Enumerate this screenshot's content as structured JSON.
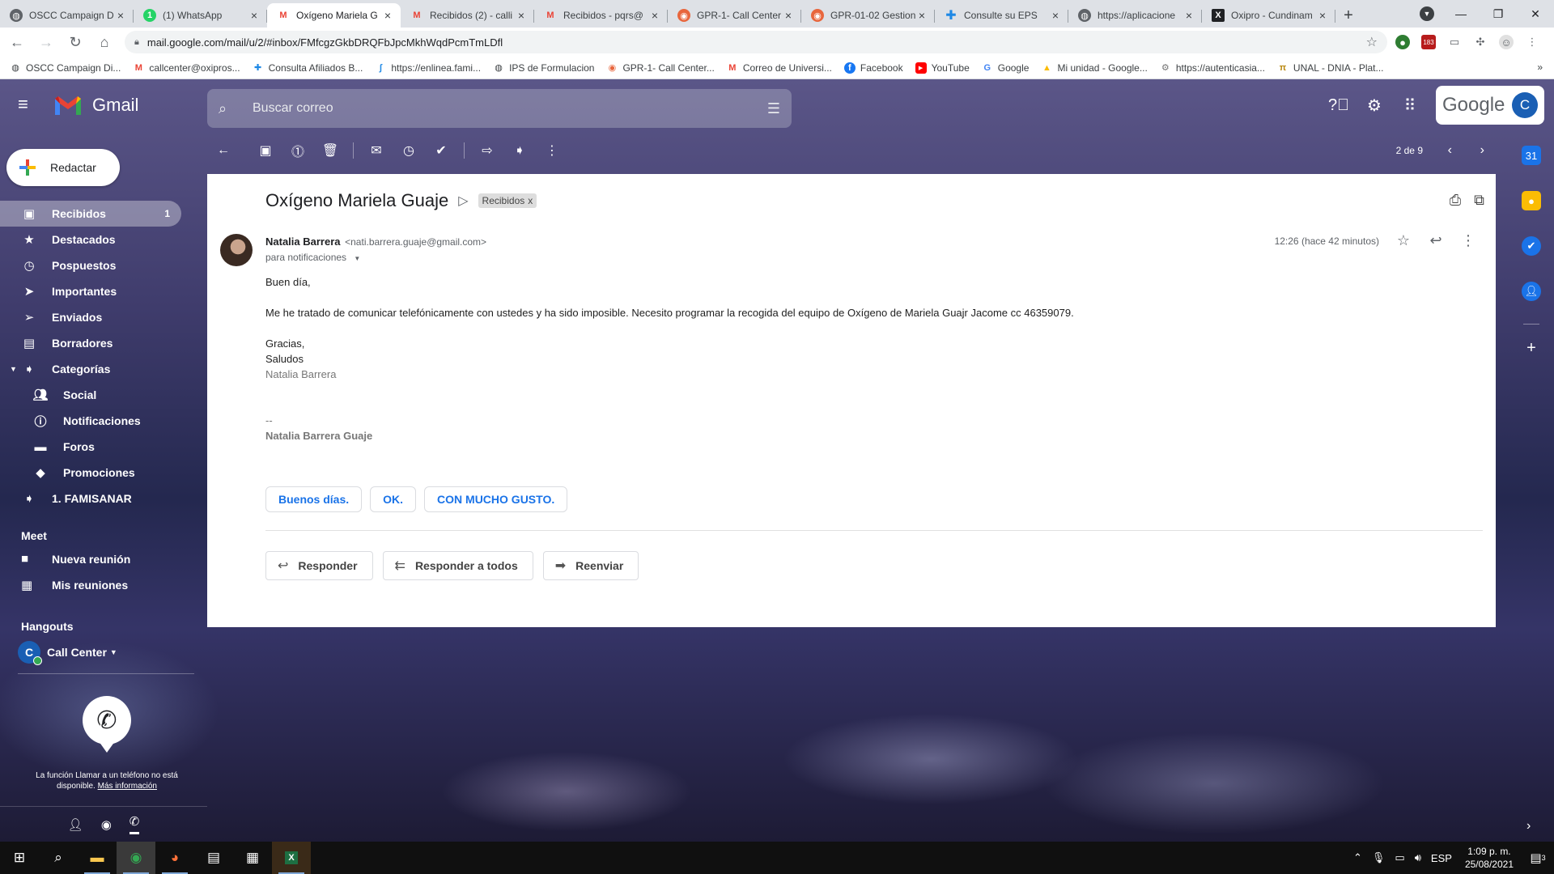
{
  "browser": {
    "tabs": [
      {
        "title": "OSCC Campaign Di",
        "favicon": "globe-icon",
        "active": false
      },
      {
        "title": "(1) WhatsApp",
        "favicon": "whatsapp-icon",
        "active": false
      },
      {
        "title": "Oxígeno Mariela G",
        "favicon": "gmail-icon",
        "active": true
      },
      {
        "title": "Recibidos (2) - calli",
        "favicon": "gmail-icon",
        "active": false
      },
      {
        "title": "Recibidos - pqrs@",
        "favicon": "gmail-icon",
        "active": false
      },
      {
        "title": "GPR-1- Call Center",
        "favicon": "gpr-icon",
        "active": false
      },
      {
        "title": "GPR-01-02 Gestion",
        "favicon": "gpr-icon",
        "active": false
      },
      {
        "title": "Consulte su EPS",
        "favicon": "cross-icon",
        "active": false
      },
      {
        "title": "https://aplicacione",
        "favicon": "globe-icon",
        "active": false
      },
      {
        "title": "Oxipro - Cundinam",
        "favicon": "oxipro-icon",
        "active": false
      }
    ],
    "url": "mail.google.com/mail/u/2/#inbox/FMfcgzGkbDRQFbJpcMkhWqdPcmTmLDfl",
    "extension_badge": "183",
    "bookmarks": [
      {
        "label": "OSCC Campaign Di...",
        "icon": "globe-icon"
      },
      {
        "label": "callcenter@oxipros...",
        "icon": "gmail-icon"
      },
      {
        "label": "Consulta Afiliados B...",
        "icon": "cross-icon"
      },
      {
        "label": "https://enlinea.fami...",
        "icon": "famisanar-icon"
      },
      {
        "label": "IPS de Formulacion",
        "icon": "globe-icon"
      },
      {
        "label": "GPR-1- Call Center...",
        "icon": "gpr-icon"
      },
      {
        "label": "Correo de Universi...",
        "icon": "gmail-icon"
      },
      {
        "label": "Facebook",
        "icon": "facebook-icon"
      },
      {
        "label": "YouTube",
        "icon": "youtube-icon"
      },
      {
        "label": "Google",
        "icon": "google-icon"
      },
      {
        "label": "Mi unidad - Google...",
        "icon": "drive-icon"
      },
      {
        "label": "https://autenticasia...",
        "icon": "gear-icon"
      },
      {
        "label": "UNAL - DNIA - Plat...",
        "icon": "unal-icon"
      }
    ],
    "bookmarks_more": "»"
  },
  "gmail": {
    "brand": "Gmail",
    "search_placeholder": "Buscar correo",
    "google_word": "Google",
    "avatar_letter": "C",
    "compose_label": "Redactar",
    "nav": [
      {
        "label": "Recibidos",
        "icon": "inbox-icon",
        "count": "1",
        "active": true
      },
      {
        "label": "Destacados",
        "icon": "star-icon"
      },
      {
        "label": "Pospuestos",
        "icon": "clock-icon"
      },
      {
        "label": "Importantes",
        "icon": "important-icon"
      },
      {
        "label": "Enviados",
        "icon": "send-icon"
      },
      {
        "label": "Borradores",
        "icon": "draft-icon"
      },
      {
        "label": "Categorías",
        "icon": "label-icon"
      },
      {
        "label": "Social",
        "icon": "people-icon"
      },
      {
        "label": "Notificaciones",
        "icon": "info-icon"
      },
      {
        "label": "Foros",
        "icon": "forum-icon"
      },
      {
        "label": "Promociones",
        "icon": "tag-icon"
      },
      {
        "label": "1. FAMISANAR",
        "icon": "label-icon"
      }
    ],
    "meet": {
      "title": "Meet",
      "items": [
        {
          "label": "Nueva reunión",
          "icon": "video-icon"
        },
        {
          "label": "Mis reuniones",
          "icon": "calendar-icon"
        }
      ]
    },
    "hangouts": {
      "title": "Hangouts",
      "user": "Call Center",
      "user_letter": "C",
      "message": "La función Llamar a un teléfono no está disponible.",
      "link": "Más información"
    },
    "toolbar": {
      "pager": "2 de 9"
    },
    "email": {
      "subject": "Oxígeno Mariela Guaje",
      "label_chip": "Recibidos",
      "label_chip_close": "x",
      "sender_name": "Natalia Barrera",
      "sender_email": "<nati.barrera.guaje@gmail.com>",
      "to_line": "para notificaciones",
      "time": "12:26 (hace 42 minutos)",
      "body": {
        "greeting": "Buen día,",
        "paragraph": "Me he tratado de comunicar telefónicamente con ustedes y ha sido imposible. Necesito programar la recogida del equipo de Oxígeno de Mariela Guajr Jacome cc 46359079.",
        "thanks": "Gracias,",
        "closing": "Saludos",
        "name": "Natalia Barrera",
        "sig_dash": "--",
        "signature": "Natalia Barrera Guaje"
      },
      "smart_replies": [
        "Buenos días.",
        "OK.",
        "CON MUCHO GUSTO."
      ],
      "actions": {
        "reply": "Responder",
        "reply_all": "Responder a todos",
        "forward": "Reenviar"
      }
    }
  },
  "taskbar": {
    "lang": "ESP",
    "time": "1:09 p. m.",
    "date": "25/08/2021",
    "notif_count": "3"
  },
  "colors": {
    "gmail_red": "#ea4335",
    "gmail_blue": "#4285f4",
    "accent_link": "#1a73e8",
    "avatar_blue": "#1a5fb4"
  }
}
